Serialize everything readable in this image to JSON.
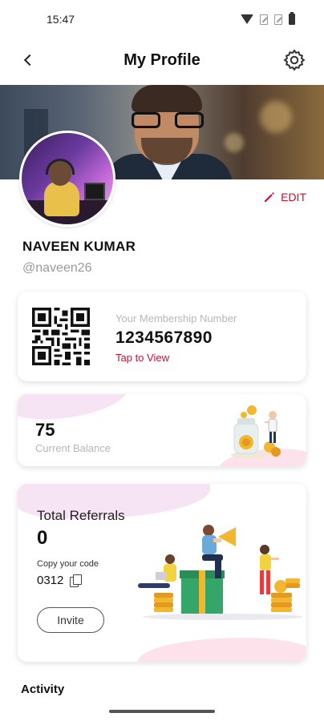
{
  "status_bar": {
    "time": "15:47"
  },
  "header": {
    "title": "My Profile"
  },
  "profile": {
    "edit_label": "EDIT",
    "name": "NAVEEN KUMAR",
    "handle": "@naveen26"
  },
  "membership": {
    "label": "Your Membership Number",
    "number": "1234567890",
    "link": "Tap to View"
  },
  "balance": {
    "value": "75",
    "label": "Current Balance"
  },
  "referrals": {
    "title": "Total Referrals",
    "count": "0",
    "copy_label": "Copy your code",
    "code": "0312",
    "invite_label": "Invite"
  },
  "activity": {
    "title": "Activity"
  },
  "colors": {
    "accent": "#c8102e",
    "muted": "#b7b7b7"
  }
}
